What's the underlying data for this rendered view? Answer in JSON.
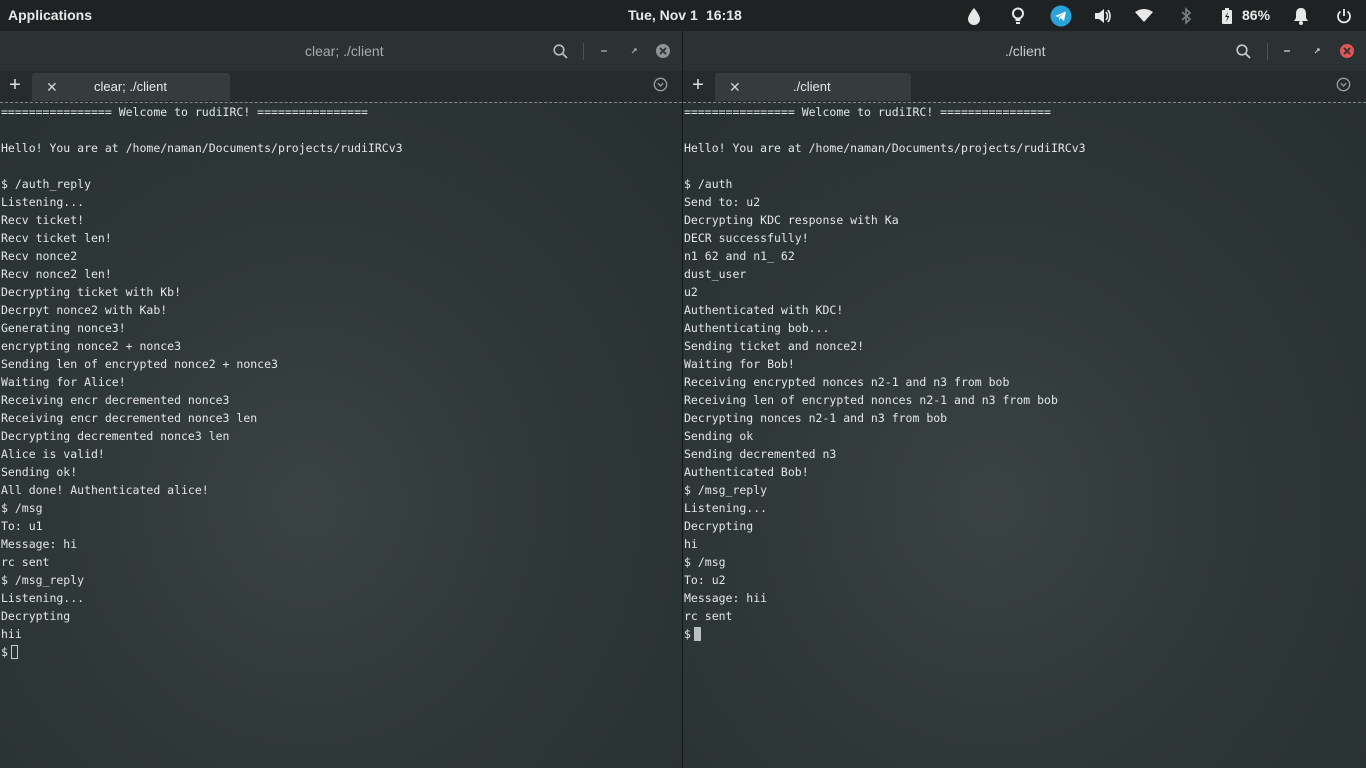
{
  "panel": {
    "applications_label": "Applications",
    "date": "Tue, Nov 1",
    "time": "16:18",
    "battery_percent": "86%",
    "tray_icons": [
      "droplet-icon",
      "lightbulb-icon",
      "telegram-icon",
      "volume-icon",
      "wifi-icon",
      "bluetooth-icon",
      "battery-icon",
      "bell-icon",
      "power-icon"
    ],
    "telegram_color": "#2aa2da"
  },
  "left_window": {
    "title": "clear; ./client",
    "tab_label": "clear; ./client",
    "lines": [
      "================ Welcome to rudiIRC! ================",
      "",
      "Hello! You are at /home/naman/Documents/projects/rudiIRCv3",
      "",
      "$ /auth_reply",
      "Listening...",
      "Recv ticket!",
      "Recv ticket len!",
      "Recv nonce2",
      "Recv nonce2 len!",
      "Decrypting ticket with Kb!",
      "Decrpyt nonce2 with Kab!",
      "Generating nonce3!",
      "encrypting nonce2 + nonce3",
      "Sending len of encrypted nonce2 + nonce3",
      "Waiting for Alice!",
      "Receiving encr decremented nonce3",
      "Receiving encr decremented nonce3 len",
      "Decrypting decremented nonce3 len",
      "Alice is valid!",
      "Sending ok!",
      "All done! Authenticated alice!",
      "$ /msg",
      "To: u1",
      "Message: hi",
      "rc sent",
      "$ /msg_reply",
      "Listening...",
      "Decrypting",
      "hii"
    ],
    "prompt": "$"
  },
  "right_window": {
    "title": "./client",
    "tab_label": "./client",
    "lines": [
      "================ Welcome to rudiIRC! ================",
      "",
      "Hello! You are at /home/naman/Documents/projects/rudiIRCv3",
      "",
      "$ /auth",
      "Send to: u2",
      "Decrypting KDC response with Ka",
      "DECR successfully!",
      "n1 62 and n1_ 62",
      "dust_user",
      "u2",
      "Authenticated with KDC!",
      "Authenticating bob...",
      "Sending ticket and nonce2!",
      "Waiting for Bob!",
      "Receiving encrypted nonces n2-1 and n3 from bob",
      "Receiving len of encrypted nonces n2-1 and n3 from bob",
      "Decrypting nonces n2-1 and n3 from bob",
      "Sending ok",
      "Sending decremented n3",
      "Authenticated Bob!",
      "$ /msg_reply",
      "Listening...",
      "Decrypting",
      "hi",
      "$ /msg",
      "To: u2",
      "Message: hii",
      "rc sent"
    ],
    "prompt": "$"
  },
  "colors": {
    "close_active": "#e05555",
    "close_inactive": "#8e9494"
  }
}
